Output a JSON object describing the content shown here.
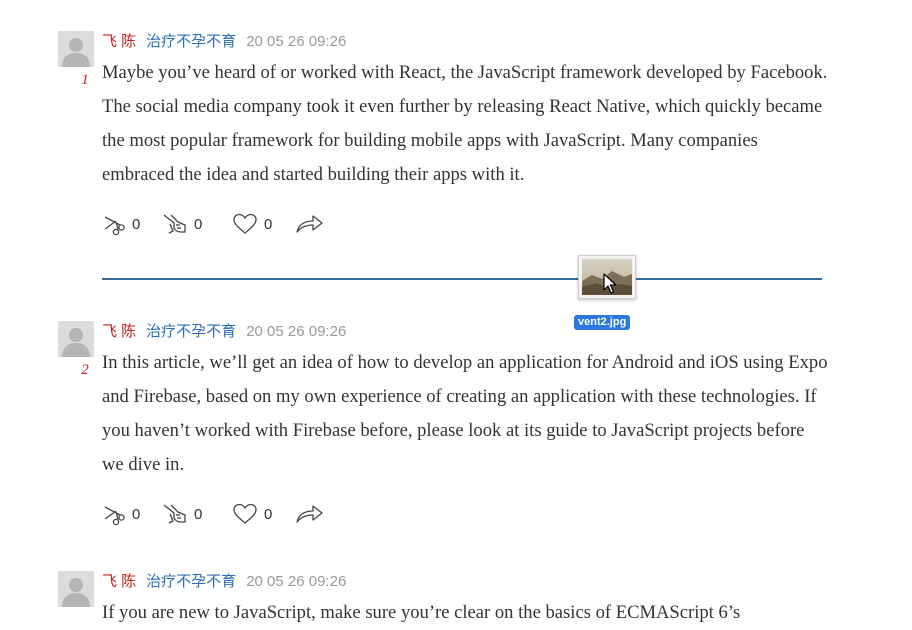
{
  "posts": [
    {
      "author": "飞 陈",
      "board": "治疗不孕不育",
      "time": "20 05 26 09:26",
      "floor": "1",
      "text": "Maybe you’ve heard of or worked with React, the JavaScript framework developed by Facebook. The social media company took it even further by releasing React Native, which quickly became the most popular framework for building mobile apps with JavaScript. Many companies embraced the idea and started building their apps with it.",
      "actions": {
        "cut": "0",
        "point": "0",
        "like": "0"
      }
    },
    {
      "author": "飞 陈",
      "board": "治疗不孕不育",
      "time": "20 05 26 09:26",
      "floor": "2",
      "text": "In this article, we’ll get an idea of how to develop an application for Android and iOS using Expo and Firebase, based on my own experience of creating an application with these technologies. If you haven’t worked with Firebase before, please look at its guide to JavaScript projects before we dive in.",
      "actions": {
        "cut": "0",
        "point": "0",
        "like": "0"
      }
    },
    {
      "author": "飞 陈",
      "board": "治疗不孕不育",
      "time": "20 05 26 09:26",
      "text": "If you are new to JavaScript, make sure you’re clear on the basics of ECMAScript 6’s"
    }
  ],
  "drag_item": {
    "filename": "vent2.jpg"
  },
  "icons": [
    "avatar-placeholder-icon",
    "scissors-icon",
    "pointing-hand-icon",
    "heart-icon",
    "share-arrow-icon",
    "pointer-cursor-icon"
  ],
  "colors": {
    "author": "#c41e1e",
    "board": "#2a6fb6",
    "time": "#999999",
    "divider": "#2f6c9c",
    "drag_label_bg": "#2a78e0"
  }
}
